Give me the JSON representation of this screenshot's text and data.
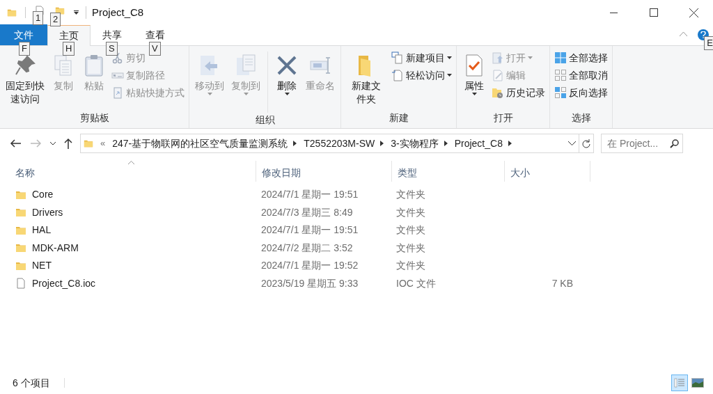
{
  "title_bar": {
    "title": "Project_C8",
    "quick_access_keytips": [
      "1",
      "2"
    ]
  },
  "ribbon": {
    "tabs": [
      {
        "label": "文件",
        "keytip": "F",
        "kind": "file"
      },
      {
        "label": "主页",
        "keytip": "H",
        "kind": "tab",
        "selected": true
      },
      {
        "label": "共享",
        "keytip": "S",
        "kind": "tab",
        "selected": false
      },
      {
        "label": "查看",
        "keytip": "V",
        "kind": "tab",
        "selected": false
      }
    ],
    "help_keytip": "E",
    "groups": [
      {
        "label": "剪贴板",
        "items": [
          {
            "kind": "large",
            "label": "固定到快速访问",
            "disabled": false,
            "has_menu": false
          },
          {
            "kind": "large",
            "label": "复制",
            "disabled": true,
            "has_menu": false
          },
          {
            "kind": "large",
            "label": "粘贴",
            "disabled": true,
            "has_menu": false
          },
          {
            "kind": "stack",
            "buttons": [
              {
                "label": "剪切",
                "disabled": true,
                "has_menu": false
              },
              {
                "label": "复制路径",
                "disabled": true,
                "has_menu": false
              },
              {
                "label": "粘贴快捷方式",
                "disabled": true,
                "has_menu": false
              }
            ]
          }
        ]
      },
      {
        "label": "组织",
        "items": [
          {
            "kind": "large",
            "label": "移动到",
            "disabled": true,
            "has_menu": true
          },
          {
            "kind": "large",
            "label": "复制到",
            "disabled": true,
            "has_menu": true
          },
          {
            "kind": "separator"
          },
          {
            "kind": "large",
            "label": "删除",
            "disabled": false,
            "has_menu": true
          },
          {
            "kind": "large",
            "label": "重命名",
            "disabled": true,
            "has_menu": false
          }
        ]
      },
      {
        "label": "新建",
        "items": [
          {
            "kind": "large",
            "label": "新建文件夹",
            "disabled": false,
            "has_menu": false
          },
          {
            "kind": "stack",
            "buttons": [
              {
                "label": "新建项目",
                "disabled": false,
                "has_menu": true
              },
              {
                "label": "轻松访问",
                "disabled": false,
                "has_menu": true
              }
            ]
          }
        ]
      },
      {
        "label": "打开",
        "items": [
          {
            "kind": "large",
            "label": "属性",
            "disabled": false,
            "has_menu": true
          },
          {
            "kind": "stack",
            "buttons": [
              {
                "label": "打开",
                "disabled": true,
                "has_menu": true
              },
              {
                "label": "编辑",
                "disabled": true,
                "has_menu": false
              },
              {
                "label": "历史记录",
                "disabled": false,
                "has_menu": false
              }
            ]
          }
        ]
      },
      {
        "label": "选择",
        "items": [
          {
            "kind": "stack",
            "buttons": [
              {
                "label": "全部选择",
                "disabled": false,
                "has_menu": false
              },
              {
                "label": "全部取消",
                "disabled": false,
                "has_menu": false
              },
              {
                "label": "反向选择",
                "disabled": false,
                "has_menu": false
              }
            ]
          }
        ]
      }
    ]
  },
  "navigation": {
    "back_disabled": false,
    "forward_disabled": true,
    "overflow": "«",
    "breadcrumbs": [
      "247-基于物联网的社区空气质量监测系统",
      "T2552203M-SW",
      "3-实物程序",
      "Project_C8"
    ],
    "search": {
      "placeholder": "在 Project..."
    }
  },
  "file_list": {
    "columns": [
      {
        "label": "名称",
        "sorted": true
      },
      {
        "label": "修改日期",
        "sorted": false
      },
      {
        "label": "类型",
        "sorted": false
      },
      {
        "label": "大小",
        "sorted": false
      }
    ],
    "rows": [
      {
        "kind": "folder",
        "name": "Core",
        "modified": "2024/7/1 星期一 19:51",
        "type": "文件夹"
      },
      {
        "kind": "folder",
        "name": "Drivers",
        "modified": "2024/7/3 星期三 8:49",
        "type": "文件夹"
      },
      {
        "kind": "folder",
        "name": "HAL",
        "modified": "2024/7/1 星期一 19:51",
        "type": "文件夹"
      },
      {
        "kind": "folder",
        "name": "MDK-ARM",
        "modified": "2024/7/2 星期二 3:52",
        "type": "文件夹"
      },
      {
        "kind": "folder",
        "name": "NET",
        "modified": "2024/7/1 星期一 19:52",
        "type": "文件夹"
      },
      {
        "kind": "file",
        "name": "Project_C8.ioc",
        "modified": "2023/5/19 星期五 9:33",
        "type": "IOC 文件",
        "size": "7 KB"
      }
    ]
  },
  "status_bar": {
    "item_count": "6 个项目",
    "views": [
      {
        "kind": "details",
        "selected": true
      },
      {
        "kind": "large_icons",
        "selected": false
      }
    ]
  }
}
